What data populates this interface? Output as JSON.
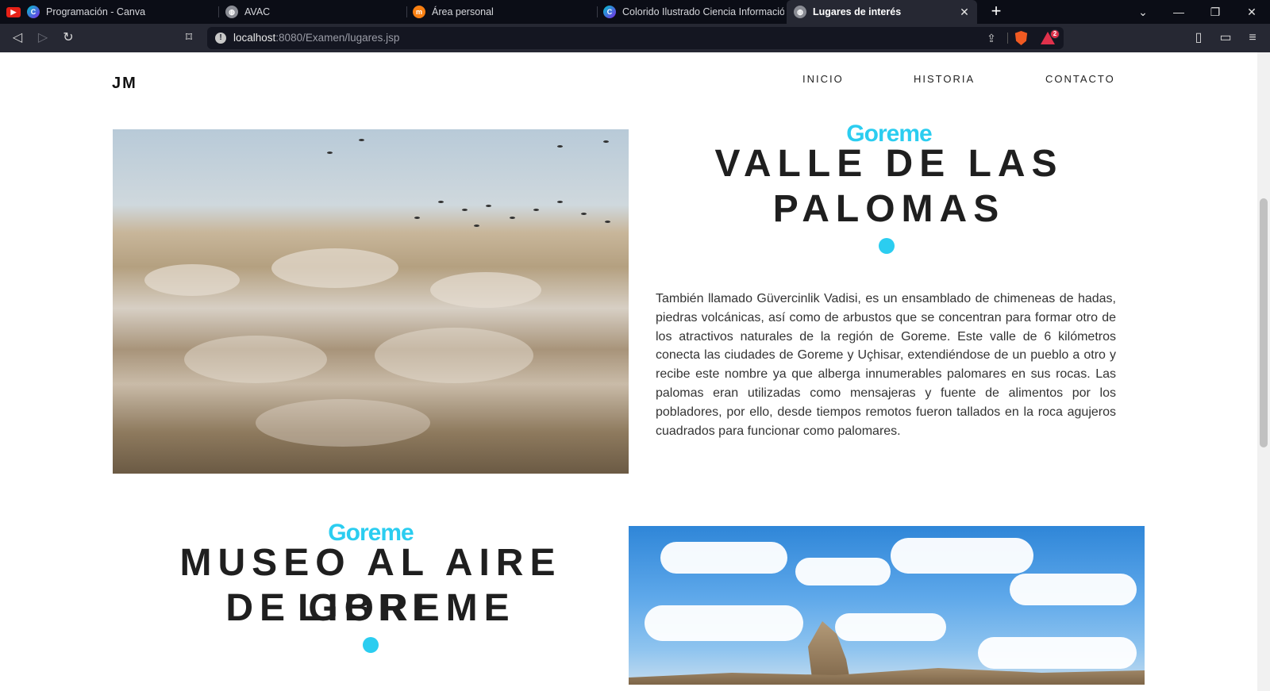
{
  "browser": {
    "tabs": [
      {
        "title": "Programación - Canva",
        "favicon": "canva-icon"
      },
      {
        "title": "AVAC",
        "favicon": "globe-icon"
      },
      {
        "title": "Área personal",
        "favicon": "moodle-icon"
      },
      {
        "title": "Colorido Ilustrado Ciencia Información",
        "favicon": "canva-icon"
      },
      {
        "title": "Lugares de interés",
        "favicon": "globe-icon",
        "active": true
      }
    ],
    "url_host": "localhost",
    "url_rest": ":8080/Examen/lugares.jsp",
    "rewards_count": "2"
  },
  "site": {
    "logo": "JM",
    "nav": [
      "INICIO",
      "HISTORIA",
      "CONTACTO"
    ]
  },
  "sections": [
    {
      "kicker": "Goreme",
      "title_line1": "VALLE DE LAS",
      "title_line2": "PALOMAS",
      "body": "También llamado Güvercinlik Vadisi, es un ensamblado de chimeneas de hadas, piedras volcánicas, así como de arbustos que se concentran para formar otro de los atractivos naturales de la región de Goreme. Este valle de 6 kilómetros conecta las ciudades de Goreme y Uçhisar, extendiéndose de un pueblo a otro y recibe este nombre ya que alberga innumerables palomares en sus rocas. Las palomas eran utilizadas como mensajeras y fuente de alimentos por los pobladores, por ello, desde tiempos remotos fueron tallados en la roca agujeros cuadrados para funcionar como palomares."
    },
    {
      "kicker": "Goreme",
      "title_line1": "MUSEO AL AIRE LIBRE",
      "title_line2": "DE GOREME"
    }
  ],
  "colors": {
    "accent": "#2bcdf0",
    "heading": "#1f1f1f",
    "chrome_bg": "#0b0d16",
    "toolbar_bg": "#262833"
  }
}
